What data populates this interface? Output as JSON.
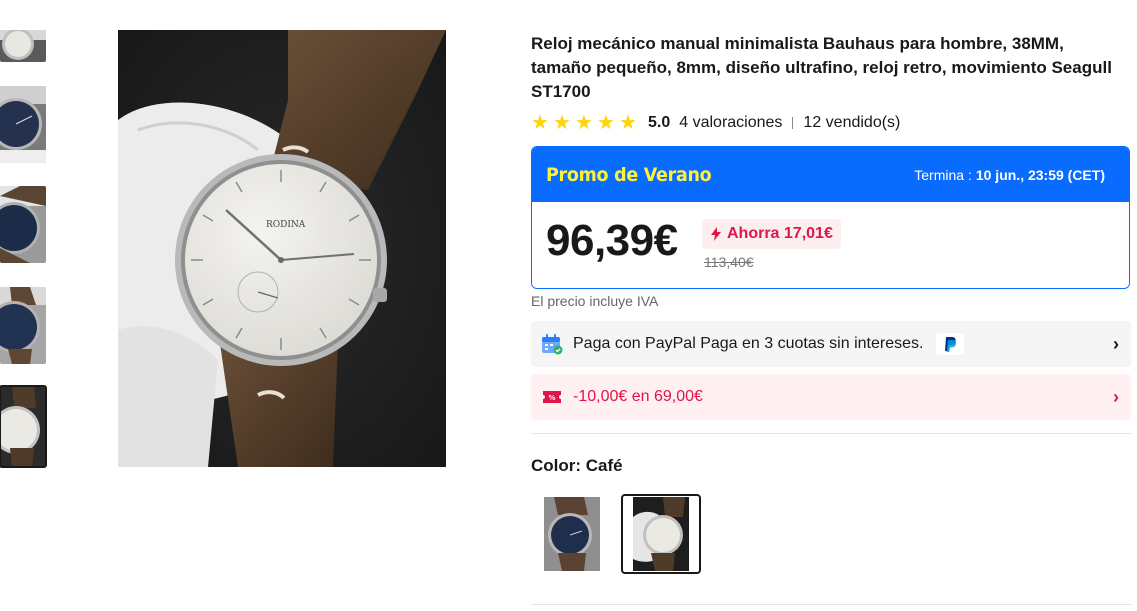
{
  "product": {
    "title": "Reloj mecánico manual minimalista Bauhaus para hombre, 38MM, tamaño pequeño, 8mm, diseño ultrafino, reloj retro, movimiento Seagull ST1700",
    "rating_score": "5.0",
    "rating_count": "4 valoraciones",
    "sold": "12 vendido(s)",
    "stars": 5,
    "dial_brand": "RODINA"
  },
  "thumbnails": [
    {
      "name": "thumb-1",
      "variant": "white-dial"
    },
    {
      "name": "thumb-2",
      "variant": "blue-dial"
    },
    {
      "name": "thumb-3",
      "variant": "blue-dial"
    },
    {
      "name": "thumb-4",
      "variant": "blue-dial"
    },
    {
      "name": "thumb-5",
      "variant": "white-dial",
      "selected": true
    }
  ],
  "promo": {
    "title": "Promo de Verano",
    "ends_label": "Termina :",
    "ends_value": "10 jun., 23:59 (CET)",
    "price": "96,39€",
    "save": "Ahorra 17,01€",
    "old_price": "113,40€"
  },
  "vat_note": "El precio incluye IVA",
  "paypal_row": {
    "text": "Paga con PayPal Paga en 3 cuotas sin intereses."
  },
  "coupon_row": {
    "text": "-10,00€ en 69,00€"
  },
  "color": {
    "label": "Color: Café",
    "options": [
      "blue-dial",
      "white-dial"
    ],
    "selected_index": 1
  },
  "colors": {
    "accent_blue": "#0a6cff",
    "promo_yellow": "#fff03a",
    "sale_red": "#e0154a",
    "star_yellow": "#fdd40f"
  }
}
